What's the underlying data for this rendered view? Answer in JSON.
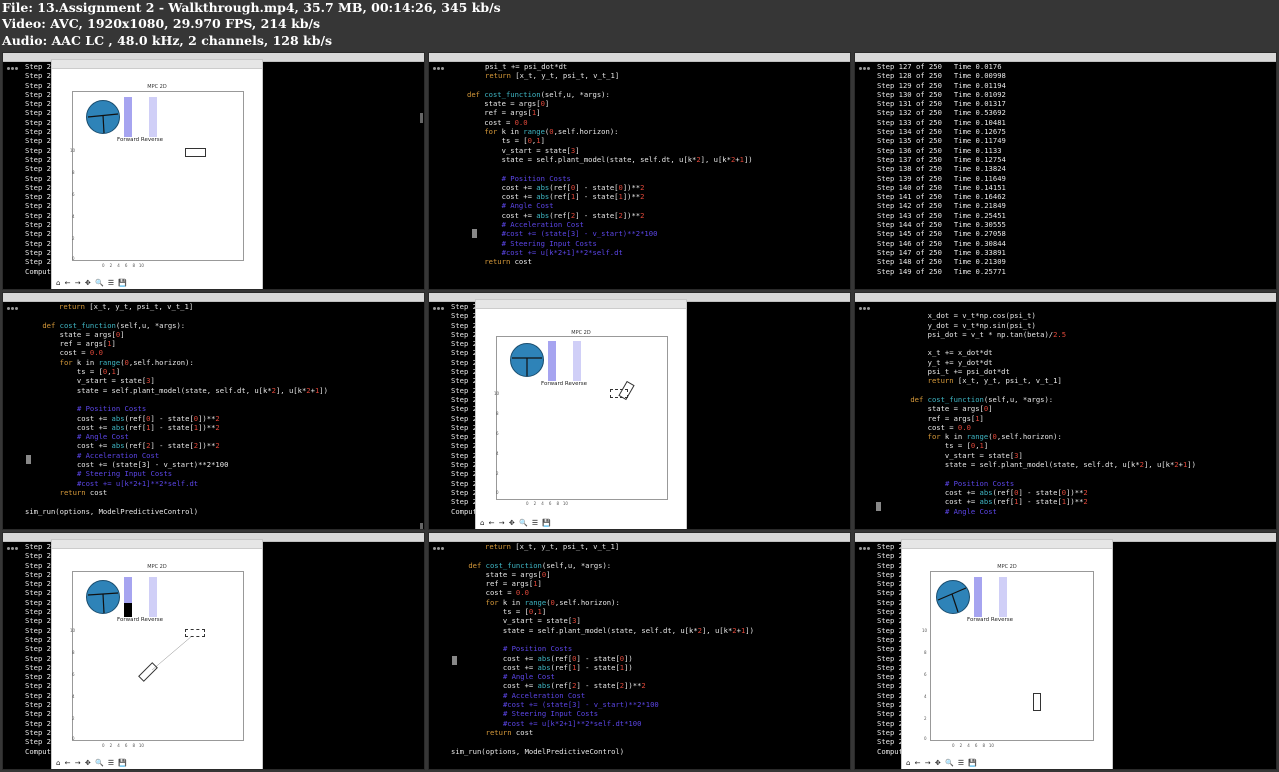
{
  "header": {
    "file_line": "File: 13.Assignment 2 - Walkthrough.mp4, 35.7 MB, 00:14:26, 345 kb/s",
    "video_line": "Video: AVC, 1920x1080, 29.970 FPS, 214 kb/s",
    "audio_line": "Audio: AAC LC , 48.0 kHz, 2 channels, 128 kb/s"
  },
  "plot": {
    "title": "MPC 2D",
    "legend": "Forward Reverse",
    "yticks": [
      "10",
      "8",
      "6",
      "4",
      "2",
      "0"
    ],
    "xticks": "0    2    4    6    8   10",
    "toolbar": "⌂ ← → ✥ 🔍 ☰ 💾"
  },
  "term_left": {
    "lines": [
      "Step 2",
      "Step 2",
      "Step 2",
      "Step 2",
      "Step 2",
      "Step 2",
      "Step 2",
      "Step 2",
      "Step 2",
      "Step 2",
      "Step 2",
      "Step 2",
      "Step 2",
      "Step 2",
      "Step 2",
      "Step 2",
      "Step 2",
      "Step 2",
      "Step 2",
      "Step 2",
      "Step 2",
      "Step 2",
      "Comput"
    ]
  },
  "steps": [
    {
      "s": "Step 127 of 250",
      "t": "Time 0.0176"
    },
    {
      "s": "Step 128 of 250",
      "t": "Time 0.00998"
    },
    {
      "s": "Step 129 of 250",
      "t": "Time 0.01194"
    },
    {
      "s": "Step 130 of 250",
      "t": "Time 0.01092"
    },
    {
      "s": "Step 131 of 250",
      "t": "Time 0.01317"
    },
    {
      "s": "Step 132 of 250",
      "t": "Time 0.53692"
    },
    {
      "s": "Step 133 of 250",
      "t": "Time 0.10481"
    },
    {
      "s": "Step 134 of 250",
      "t": "Time 0.12675"
    },
    {
      "s": "Step 135 of 250",
      "t": "Time 0.11749"
    },
    {
      "s": "Step 136 of 250",
      "t": "Time 0.1133"
    },
    {
      "s": "Step 137 of 250",
      "t": "Time 0.12754"
    },
    {
      "s": "Step 138 of 250",
      "t": "Time 0.13824"
    },
    {
      "s": "Step 139 of 250",
      "t": "Time 0.11649"
    },
    {
      "s": "Step 140 of 250",
      "t": "Time 0.14151"
    },
    {
      "s": "Step 141 of 250",
      "t": "Time 0.16462"
    },
    {
      "s": "Step 142 of 250",
      "t": "Time 0.21849"
    },
    {
      "s": "Step 143 of 250",
      "t": "Time 0.25451"
    },
    {
      "s": "Step 144 of 250",
      "t": "Time 0.30555"
    },
    {
      "s": "Step 145 of 250",
      "t": "Time 0.27058"
    },
    {
      "s": "Step 146 of 250",
      "t": "Time 0.30844"
    },
    {
      "s": "Step 147 of 250",
      "t": "Time 0.33891"
    },
    {
      "s": "Step 148 of 250",
      "t": "Time 0.21309"
    },
    {
      "s": "Step 149 of 250",
      "t": "Time 0.25771"
    }
  ],
  "code": {
    "psi_t": "psi_t += psi_dot*dt",
    "return_xt": "return [x_t, y_t, psi_t, v_t_1]",
    "def": "def ",
    "cost_fn": "cost_function",
    "cost_args": "(self,u, *args):",
    "state": "state = args[",
    "ref": "ref = args[",
    "cost0": "cost = ",
    "zero": "0.0",
    "for": "for ",
    "k_in": "k in ",
    "range": "range",
    "range_args": "(0,self.horizon):",
    "ts": "ts = [0,1]",
    "v_start": "v_start = state[3]",
    "plant": "state = self.plant_model(state, self.dt, u[k*2], u[k*2+1])",
    "pos_cm": "# Position Costs",
    "pos0": "cost += abs(ref[0] - state[0])**2",
    "pos1": "cost += abs(ref[1] - state[1])**2",
    "ang_cm": "# Angle Cost",
    "ang": "cost += abs(ref[2] - state[2])**2",
    "acc_cm": "# Acceleration Cost",
    "acc_c": "#cost += (state[3] - v_start)**2*100",
    "acc": "cost += (state[3] - v_start)**2*100",
    "steer_cm": "# Steering Input Costs",
    "steer": "#cost += u[k*2+1]**2*self.dt",
    "steer2": "#cost += u[k*2+1]**2*self.dt*100",
    "ret_cost": "return cost",
    "sim_run": "sim_run(options, ModelPredictiveControl)",
    "x_dot": "x_dot = v_t*np.cos(psi_t)",
    "y_dot": "y_dot = v_t*np.sin(psi_t)",
    "psi_dot": "psi_dot = v_t * np.tan(beta)/2.5",
    "x_t": "x_t += x_dot*dt",
    "y_t": "y_t += y_dot*dt"
  }
}
